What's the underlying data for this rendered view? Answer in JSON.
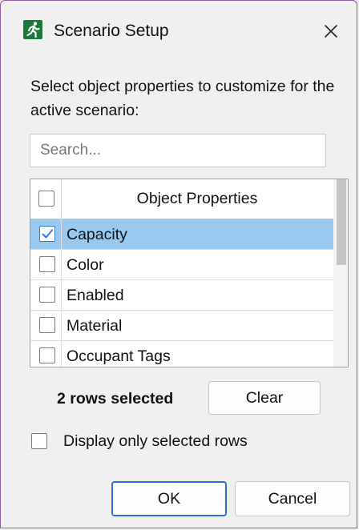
{
  "window": {
    "title": "Scenario Setup",
    "accent_color": "#2f7bd8",
    "app_icon": "running-person-icon",
    "close_icon": "close-icon"
  },
  "prompt": "Select object properties to customize for the active scenario:",
  "search": {
    "placeholder": "Search...",
    "value": ""
  },
  "table": {
    "header": "Object Properties",
    "rows": [
      {
        "label": "Capacity",
        "checked": true,
        "selected": true
      },
      {
        "label": "Color",
        "checked": false,
        "selected": false
      },
      {
        "label": "Enabled",
        "checked": false,
        "selected": false
      },
      {
        "label": "Material",
        "checked": false,
        "selected": false
      },
      {
        "label": "Occupant Tags",
        "checked": false,
        "selected": false
      }
    ]
  },
  "status": "2 rows selected",
  "clear_label": "Clear",
  "display_only_selected": {
    "label": "Display only selected rows",
    "checked": false
  },
  "ok_label": "OK",
  "cancel_label": "Cancel"
}
